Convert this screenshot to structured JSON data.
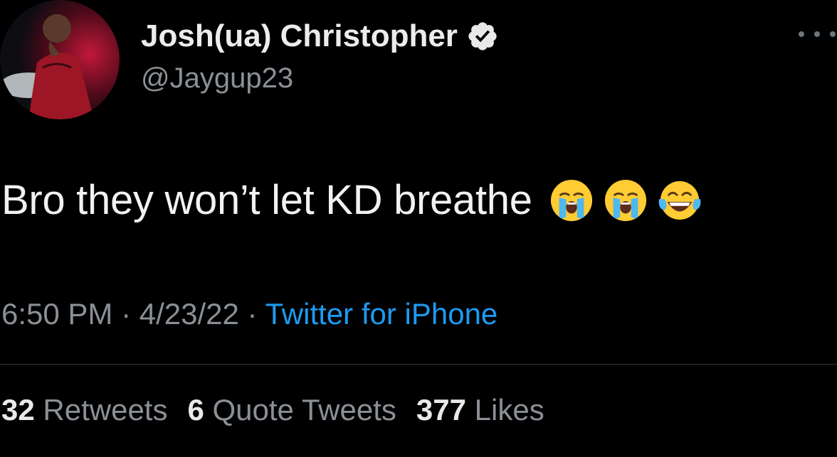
{
  "tweet": {
    "author": {
      "display_name": "Josh(ua) Christopher",
      "handle": "@Jaygup23",
      "verified_icon": "verified-badge-icon",
      "avatar": "profile-avatar"
    },
    "more_icon": "more-options-icon",
    "text": "Bro they won’t let KD breathe",
    "emojis": [
      "loudly-crying-face",
      "loudly-crying-face",
      "face-with-tears-of-joy"
    ],
    "time": "6:50 PM",
    "separator": " · ",
    "date": "4/23/22",
    "source": "Twitter for iPhone",
    "stats": {
      "retweets_count": "32",
      "retweets_label": "Retweets",
      "quotes_count": "6",
      "quotes_label": "Quote Tweets",
      "likes_count": "377",
      "likes_label": "Likes"
    }
  },
  "colors": {
    "background": "#000000",
    "primary_text": "#e7e9ea",
    "secondary_text": "#8b9096",
    "link": "#1d9bf0",
    "divider": "#2f3336"
  }
}
